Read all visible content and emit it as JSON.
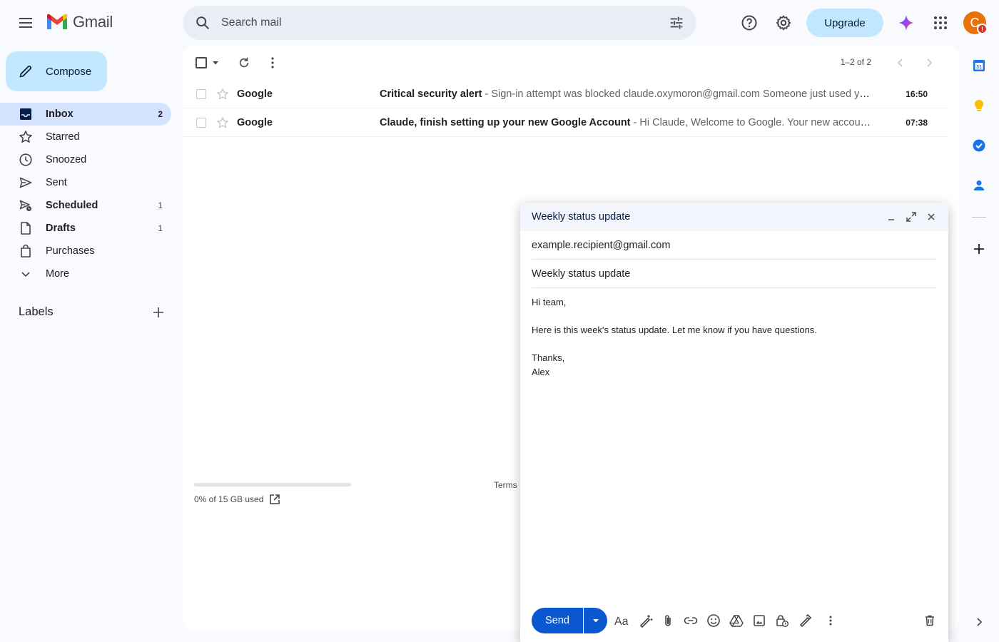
{
  "header": {
    "logo_text": "Gmail",
    "search_placeholder": "Search mail",
    "upgrade_label": "Upgrade",
    "avatar_letter": "C",
    "avatar_badge": "!"
  },
  "sidebar": {
    "compose_label": "Compose",
    "items": [
      {
        "label": "Inbox",
        "count": "2",
        "icon": "inbox-icon",
        "active": true,
        "bold": true
      },
      {
        "label": "Starred",
        "count": "",
        "icon": "star-icon"
      },
      {
        "label": "Snoozed",
        "count": "",
        "icon": "clock-icon"
      },
      {
        "label": "Sent",
        "count": "",
        "icon": "send-icon"
      },
      {
        "label": "Scheduled",
        "count": "1",
        "icon": "scheduled-icon",
        "bold": true
      },
      {
        "label": "Drafts",
        "count": "1",
        "icon": "draft-icon",
        "bold": true
      },
      {
        "label": "Purchases",
        "count": "",
        "icon": "bag-icon"
      },
      {
        "label": "More",
        "count": "",
        "icon": "chevron-down-icon"
      }
    ],
    "labels_title": "Labels"
  },
  "toolbar": {
    "page_range": "1–2 of 2"
  },
  "emails": [
    {
      "sender": "Google",
      "subject": "Critical security alert",
      "snippet": " - Sign-in attempt was blocked claude.oxymoron@gmail.com Someone just used your password to try to sign in to your account",
      "time": "16:50"
    },
    {
      "sender": "Google",
      "subject": "Claude, finish setting up your new Google Account",
      "snippet": " - Hi Claude, Welcome to Google. Your new account comes with access to Google products, apps, and services",
      "time": "07:38"
    }
  ],
  "footer": {
    "storage_text": "0% of 15 GB used",
    "storage_used_fraction": 0.0,
    "terms_label": "Terms"
  },
  "compose": {
    "window_title": "Weekly status update",
    "to": "example.recipient@gmail.com",
    "subject": "Weekly status update",
    "body_lines": [
      "Hi team,",
      "",
      "Here is this week's status update. Let me know if you have questions.",
      "",
      "Thanks,",
      "Alex"
    ],
    "send_label": "Send"
  },
  "side_apps": [
    "calendar-icon",
    "keep-icon",
    "tasks-icon",
    "contacts-icon",
    "add-app-icon"
  ],
  "colors": {
    "accent": "#0b57d0",
    "compose_bg": "#c2e7ff",
    "active_nav": "#d3e3fd",
    "avatar": "#e8710a",
    "alert": "#d93025"
  }
}
